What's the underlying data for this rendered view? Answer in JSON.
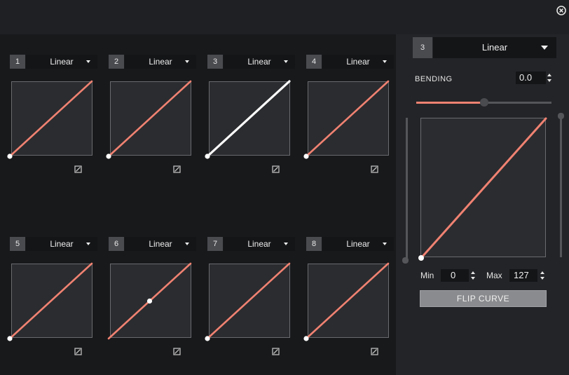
{
  "window": {
    "close_icon": "close-circle-icon"
  },
  "slots": [
    {
      "number": "1",
      "curve": "Linear",
      "style": "normal"
    },
    {
      "number": "2",
      "curve": "Linear",
      "style": "normal"
    },
    {
      "number": "3",
      "curve": "Linear",
      "style": "selected"
    },
    {
      "number": "4",
      "curve": "Linear",
      "style": "normal"
    },
    {
      "number": "5",
      "curve": "Linear",
      "style": "normal"
    },
    {
      "number": "6",
      "curve": "Linear",
      "style": "midpoint"
    },
    {
      "number": "7",
      "curve": "Linear",
      "style": "normal"
    },
    {
      "number": "8",
      "curve": "Linear",
      "style": "normal"
    }
  ],
  "editor": {
    "number": "3",
    "curve": "Linear",
    "bending_label": "BENDING",
    "bending_value": "0.0",
    "bending_slider_fraction": 0.5,
    "min_label": "Min",
    "min_value": "0",
    "max_label": "Max",
    "max_value": "127",
    "flip_label": "FLIP CURVE"
  },
  "colors": {
    "curve": "#f08272",
    "selected_curve": "#ffffff",
    "bg": "#1f2023"
  }
}
